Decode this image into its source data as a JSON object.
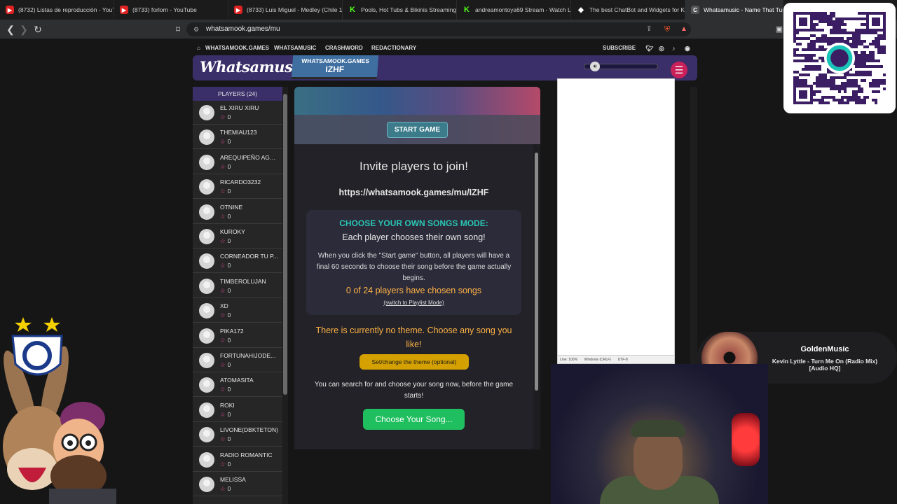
{
  "browser": {
    "tabs": [
      {
        "title": "(8732) Listas de reproducción - YouTu",
        "icon": "youtube"
      },
      {
        "title": "(8733) forlorn - YouTube",
        "icon": "youtube"
      },
      {
        "title": "(8733) Luis Miguel - Medley (Chile 1",
        "icon": "youtube"
      },
      {
        "title": "Pools, Hot Tubs & Bikinis Streaming",
        "icon": "kick"
      },
      {
        "title": "andreamontoya69 Stream - Watch L",
        "icon": "kick"
      },
      {
        "title": "The best ChatBot and Widgets for K",
        "icon": "botrix"
      },
      {
        "title": "Whatsamusic - Name That Tune",
        "icon": "whatsamusic",
        "active": true
      }
    ],
    "url": "whatsamook.games/mu"
  },
  "site_nav": {
    "home": "WHATSAMOOK.GAMES",
    "links": [
      "WHATSAMUSIC",
      "CRASHWORD",
      "REDACTIONARY"
    ],
    "subscribe": "SUBSCRIBE",
    "social_icons": [
      "twitter-icon",
      "instagram-icon",
      "tiktok-icon",
      "discord-icon"
    ]
  },
  "banner": {
    "logo": "Whatsamusic",
    "room_site": "WHATSAMOOK.GAMES",
    "room_code": "IZHF"
  },
  "players": {
    "header": "PLAYERS (24)",
    "list": [
      {
        "name": "EL XIRU XIRU",
        "score": "0"
      },
      {
        "name": "THEMIAU123",
        "score": "0"
      },
      {
        "name": "AREQUIPEÑO AGN...",
        "score": "0"
      },
      {
        "name": "RICARDO3232",
        "score": "0"
      },
      {
        "name": "OTNINE",
        "score": "0"
      },
      {
        "name": "KUROKY",
        "score": "0"
      },
      {
        "name": "CORNEADOR TU P...",
        "score": "0"
      },
      {
        "name": "TIMBEROLUJAN",
        "score": "0"
      },
      {
        "name": "XD",
        "score": "0"
      },
      {
        "name": "PIKA172",
        "score": "0"
      },
      {
        "name": "FORTUNAHIJODE...",
        "score": "0"
      },
      {
        "name": "ATOMASITA",
        "score": "0"
      },
      {
        "name": "ROKI",
        "score": "0"
      },
      {
        "name": "LIVONE(DBKTETON)",
        "score": "0"
      },
      {
        "name": "RADIO ROMANTIC",
        "score": "0"
      },
      {
        "name": "MELISSA",
        "score": "0"
      }
    ]
  },
  "game": {
    "start_button": "START GAME",
    "invite_heading": "Invite players to join!",
    "invite_url": "https://whatsamook.games/mu/IZHF",
    "mode_title": "CHOOSE YOUR OWN SONGS MODE:",
    "mode_subtitle": "Each player chooses their own song!",
    "mode_description": "When you click the \"Start game\" button, all players will have a final 60 seconds to choose their song before the game actually begins.",
    "chosen_count": "0 of 24 players have chosen songs",
    "switch_link": "(switch to Playlist Mode)",
    "no_theme": "There is currently no theme. Choose any song you like!",
    "theme_button": "Set/change the theme (optional)",
    "search_note": "You can search for and choose your song now, before the game starts!",
    "choose_button": "Choose Your Song..."
  },
  "editor_status": {
    "line": "Line: 100%",
    "eol": "Windows (CRLF)",
    "encoding": "UTF-8"
  },
  "now_playing": {
    "station": "GoldenMusic",
    "track": "Kevin Lyttle - Turn Me On (Radio Mix) [Audio HQ]"
  },
  "colors": {
    "banner": "#3a2f68",
    "mode_title": "#29c6b4",
    "highlight": "#ffb347",
    "theme_button": "#d4a100",
    "choose_button": "#1fbf5f",
    "star": "#ff4fa6"
  }
}
